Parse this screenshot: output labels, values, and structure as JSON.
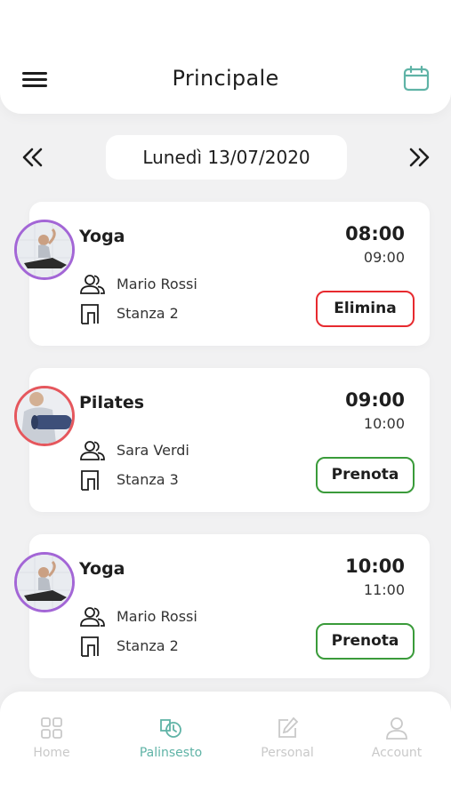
{
  "header": {
    "title": "Principale",
    "menu_icon": "hamburger-menu-icon",
    "calendar_icon": "calendar-icon",
    "accent_color": "#5fb3a6"
  },
  "date_nav": {
    "date": "Lunedì 13/07/2020",
    "prev_icon": "double-chevron-left-icon",
    "next_icon": "double-chevron-right-icon"
  },
  "classes": [
    {
      "course": "Yoga",
      "start": "08:00",
      "end": "09:00",
      "instructor": "Mario Rossi",
      "room": "Stanza 2",
      "action": "Elimina",
      "action_color": "#e72a2f",
      "avatar": "yoga-avatar"
    },
    {
      "course": "Pilates",
      "start": "09:00",
      "end": "10:00",
      "instructor": "Sara Verdi",
      "room": "Stanza 3",
      "action": "Prenota",
      "action_color": "#3a9b3a",
      "avatar": "pilates-avatar"
    },
    {
      "course": "Yoga",
      "start": "10:00",
      "end": "11:00",
      "instructor": "Mario Rossi",
      "room": "Stanza 2",
      "action": "Prenota",
      "action_color": "#3a9b3a",
      "avatar": "yoga-avatar"
    }
  ],
  "tabbar": {
    "tabs": [
      {
        "label": "Home",
        "icon": "grid-icon",
        "active": false
      },
      {
        "label": "Palinsesto",
        "icon": "schedule-icon",
        "active": true
      },
      {
        "label": "Personal",
        "icon": "edit-icon",
        "active": false
      },
      {
        "label": "Account",
        "icon": "user-icon",
        "active": false
      }
    ]
  }
}
